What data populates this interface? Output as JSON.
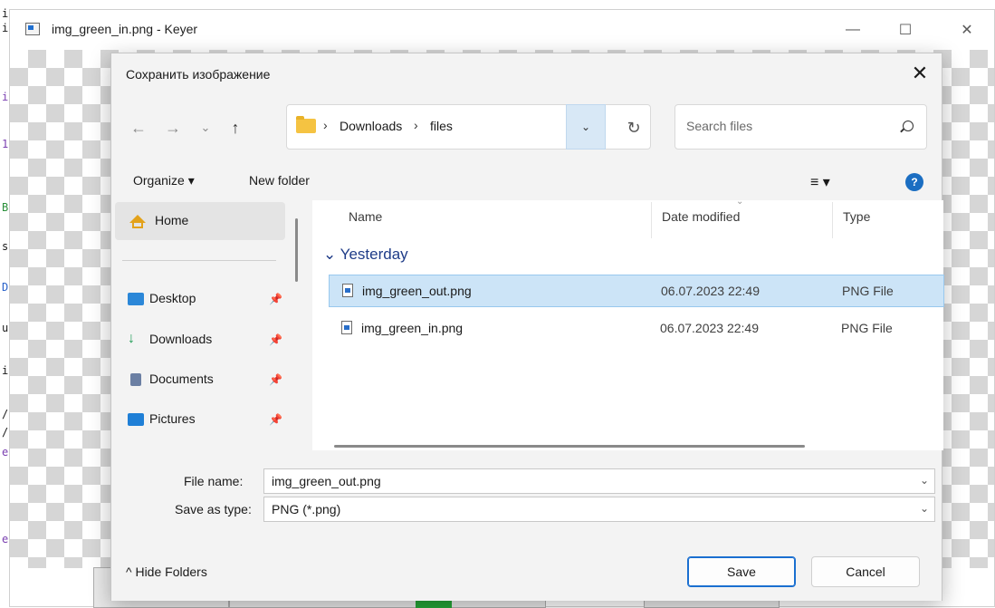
{
  "main_window": {
    "title": "img_green_in.png - Keyer",
    "minimize": "—",
    "maximize": "☐",
    "close": "✕"
  },
  "editor_chars": [
    "i",
    "i",
    "i",
    "1",
    "B",
    "s",
    "D",
    "u",
    "i",
    "/",
    "/",
    "e",
    "e"
  ],
  "dialog": {
    "title": "Сохранить изображение",
    "close": "✕",
    "nav": {
      "back": "←",
      "forward": "→",
      "recent": "⌄",
      "up": "↑",
      "refresh": "↻",
      "address_dropdown": "⌄"
    },
    "breadcrumb": [
      "Downloads",
      "files"
    ],
    "breadcrumb_separator": "›",
    "search_placeholder": "Search files",
    "command_bar": {
      "organize": "Organize ▾",
      "new_folder": "New folder",
      "view": "≡ ▾",
      "help": "?"
    },
    "nav_pane": {
      "home": "Home",
      "items": [
        {
          "label": "Desktop",
          "icon": "desktop-icon",
          "color": "#2b87d8"
        },
        {
          "label": "Downloads",
          "icon": "download-icon",
          "color": "#1f9d55"
        },
        {
          "label": "Documents",
          "icon": "documents-icon",
          "color": "#6b7fa3"
        },
        {
          "label": "Pictures",
          "icon": "pictures-icon",
          "color": "#1f7fd6"
        }
      ],
      "pin": "📌"
    },
    "columns": {
      "name": "Name",
      "date_modified": "Date modified",
      "type": "Type"
    },
    "group": "Yesterday",
    "group_chevron": "⌄",
    "files": [
      {
        "name": "img_green_out.png",
        "date": "06.07.2023 22:49",
        "type": "PNG File",
        "selected": true
      },
      {
        "name": "img_green_in.png",
        "date": "06.07.2023 22:49",
        "type": "PNG File",
        "selected": false
      }
    ],
    "form": {
      "file_name_label": "File name:",
      "file_name_value": "img_green_out.png",
      "save_type_label": "Save as type:",
      "save_type_value": "PNG (*.png)",
      "dropdown": "⌄"
    },
    "footer": {
      "hide_folders": "^  Hide Folders",
      "save": "Save",
      "cancel": "Cancel"
    }
  }
}
